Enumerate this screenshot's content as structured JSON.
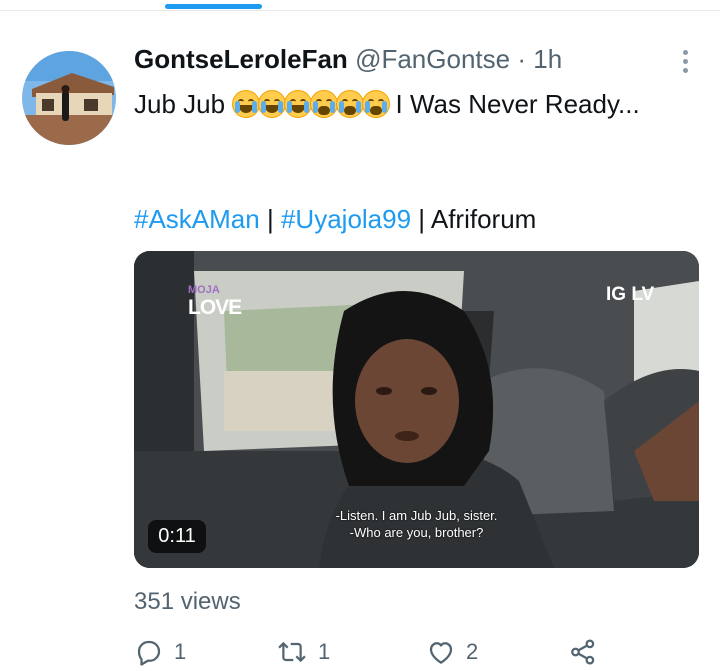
{
  "tweet": {
    "display_name": "GontseLeroleFan",
    "handle": "@FanGontse",
    "separator": "·",
    "time": "1h",
    "text_start": "Jub Jub ",
    "emojis": [
      "rolling-on-floor-laughing",
      "rolling-on-floor-laughing",
      "rolling-on-floor-laughing",
      "loudly-crying",
      "loudly-crying",
      "loudly-crying"
    ],
    "text_end": " I Was Never Ready...",
    "hashtag_1": "#AskAMan",
    "hashtag_2": "#Uyajola99",
    "pipe": "|",
    "plain_tag": "Afriforum"
  },
  "media": {
    "logo_left_top": "MOJA",
    "logo_left_bottom": "LOVE",
    "logo_right": "IG LV",
    "subtitle_line1": "-Listen. I am Jub Jub, sister.",
    "subtitle_line2": "-Who are you, brother?",
    "duration": "0:11"
  },
  "stats": {
    "views": "351 views"
  },
  "actions": {
    "reply_icon": "reply-icon",
    "reply_count": "1",
    "retweet_icon": "retweet-icon",
    "retweet_count": "1",
    "like_icon": "heart-icon",
    "like_count": "2",
    "share_icon": "share-icon"
  },
  "colors": {
    "accent": "#1d9bf0",
    "secondary_text": "#536471",
    "primary_text": "#0f1419"
  }
}
